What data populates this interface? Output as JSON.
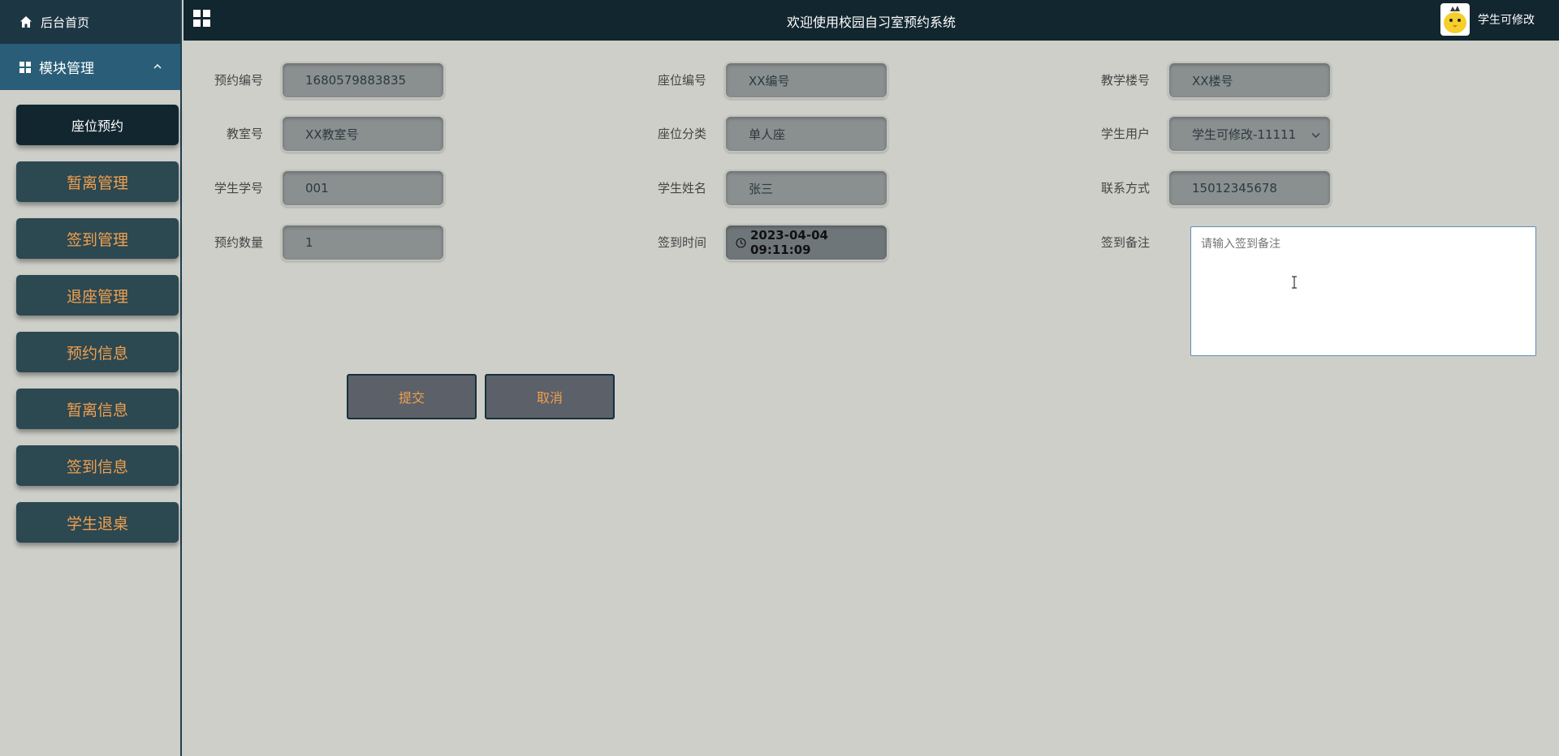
{
  "sidebar": {
    "home_label": "后台首页",
    "module_label": "模块管理",
    "items": [
      {
        "label": "座位预约",
        "active": true
      },
      {
        "label": "暂离管理"
      },
      {
        "label": "签到管理"
      },
      {
        "label": "退座管理"
      },
      {
        "label": "预约信息"
      },
      {
        "label": "暂离信息"
      },
      {
        "label": "签到信息"
      },
      {
        "label": "学生退桌"
      }
    ]
  },
  "header": {
    "title": "欢迎使用校园自习室预约系统",
    "user_name": "学生可修改"
  },
  "form": {
    "booking_no": {
      "label": "预约编号",
      "value": "1680579883835"
    },
    "seat_no": {
      "label": "座位编号",
      "value": "XX编号"
    },
    "building_no": {
      "label": "教学楼号",
      "value": "XX楼号"
    },
    "classroom_no": {
      "label": "教室号",
      "value": "XX教室号"
    },
    "seat_type": {
      "label": "座位分类",
      "value": "单人座"
    },
    "student_user": {
      "label": "学生用户",
      "value": "学生可修改-11111"
    },
    "student_id": {
      "label": "学生学号",
      "value": "001"
    },
    "student_name": {
      "label": "学生姓名",
      "value": "张三"
    },
    "contact": {
      "label": "联系方式",
      "value": "15012345678"
    },
    "booking_count": {
      "label": "预约数量",
      "value": "1"
    },
    "checkin_time": {
      "label": "签到时间",
      "value": "2023-04-04 09:11:09"
    },
    "checkin_note": {
      "label": "签到备注",
      "placeholder": "请输入签到备注"
    }
  },
  "buttons": {
    "submit": "提交",
    "cancel": "取消"
  },
  "colors": {
    "topbar": "#12262f",
    "module_header": "#2a5e78",
    "menu_item": "#2c4851",
    "menu_text": "#f0a050",
    "background": "#cecfc9"
  }
}
